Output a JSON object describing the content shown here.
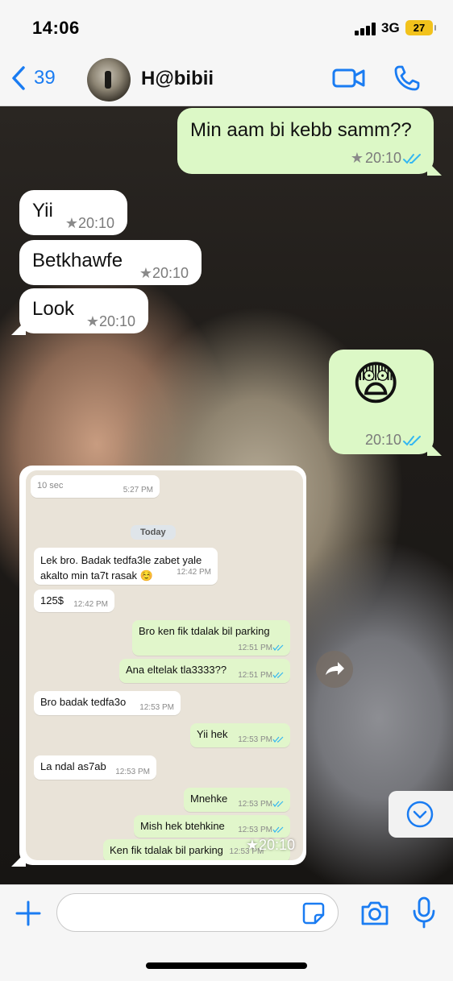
{
  "status": {
    "time": "14:06",
    "network": "3G",
    "battery": "27"
  },
  "header": {
    "back_count": "39",
    "contact_name": "H@bibii"
  },
  "messages": [
    {
      "direction": "out",
      "text": "Min aam bi kebb samm??",
      "time": "20:10",
      "starred": true,
      "read": true
    },
    {
      "direction": "in",
      "text": "Yii",
      "time": "20:10",
      "starred": true
    },
    {
      "direction": "in",
      "text": "Betkhawfe",
      "time": "20:10",
      "starred": true
    },
    {
      "direction": "in",
      "text": "Look",
      "time": "20:10",
      "starred": true
    },
    {
      "direction": "out",
      "text": "😨",
      "time": "20:10",
      "starred": false,
      "read": true
    }
  ],
  "screenshot": {
    "top_time": "5:27 PM",
    "top_label": "10 sec",
    "date_label": "Today",
    "messages": [
      {
        "direction": "in",
        "text": "Lek bro. Badak tedfa3le zabet yale akalto min ta7t rasak ☺️",
        "time": "12:42 PM"
      },
      {
        "direction": "in",
        "text": "125$",
        "time": "12:42 PM"
      },
      {
        "direction": "out",
        "text": "Bro ken fik tdalak bil parking",
        "time": "12:51 PM"
      },
      {
        "direction": "out",
        "text": "Ana eltelak tla3333??",
        "time": "12:51 PM"
      },
      {
        "direction": "in",
        "text": "Bro badak tedfa3o",
        "time": "12:53 PM"
      },
      {
        "direction": "out",
        "text": "Yii hek",
        "time": "12:53 PM"
      },
      {
        "direction": "in",
        "text": "La ndal as7ab",
        "time": "12:53 PM"
      },
      {
        "direction": "out",
        "text": "Mnehke",
        "time": "12:53 PM"
      },
      {
        "direction": "out",
        "text": "Mish hek btehkine",
        "time": "12:53 PM"
      },
      {
        "direction": "out",
        "text": "Ken fik tdalak bil parking",
        "time": "12:53 PM"
      }
    ],
    "stamp_time": "20:10"
  },
  "composer": {
    "value": "",
    "placeholder": ""
  },
  "colors": {
    "accent": "#1a7cf2",
    "outgoing": "#dcf8c6",
    "incoming": "#ffffff",
    "read_ticks": "#34b7f1"
  }
}
